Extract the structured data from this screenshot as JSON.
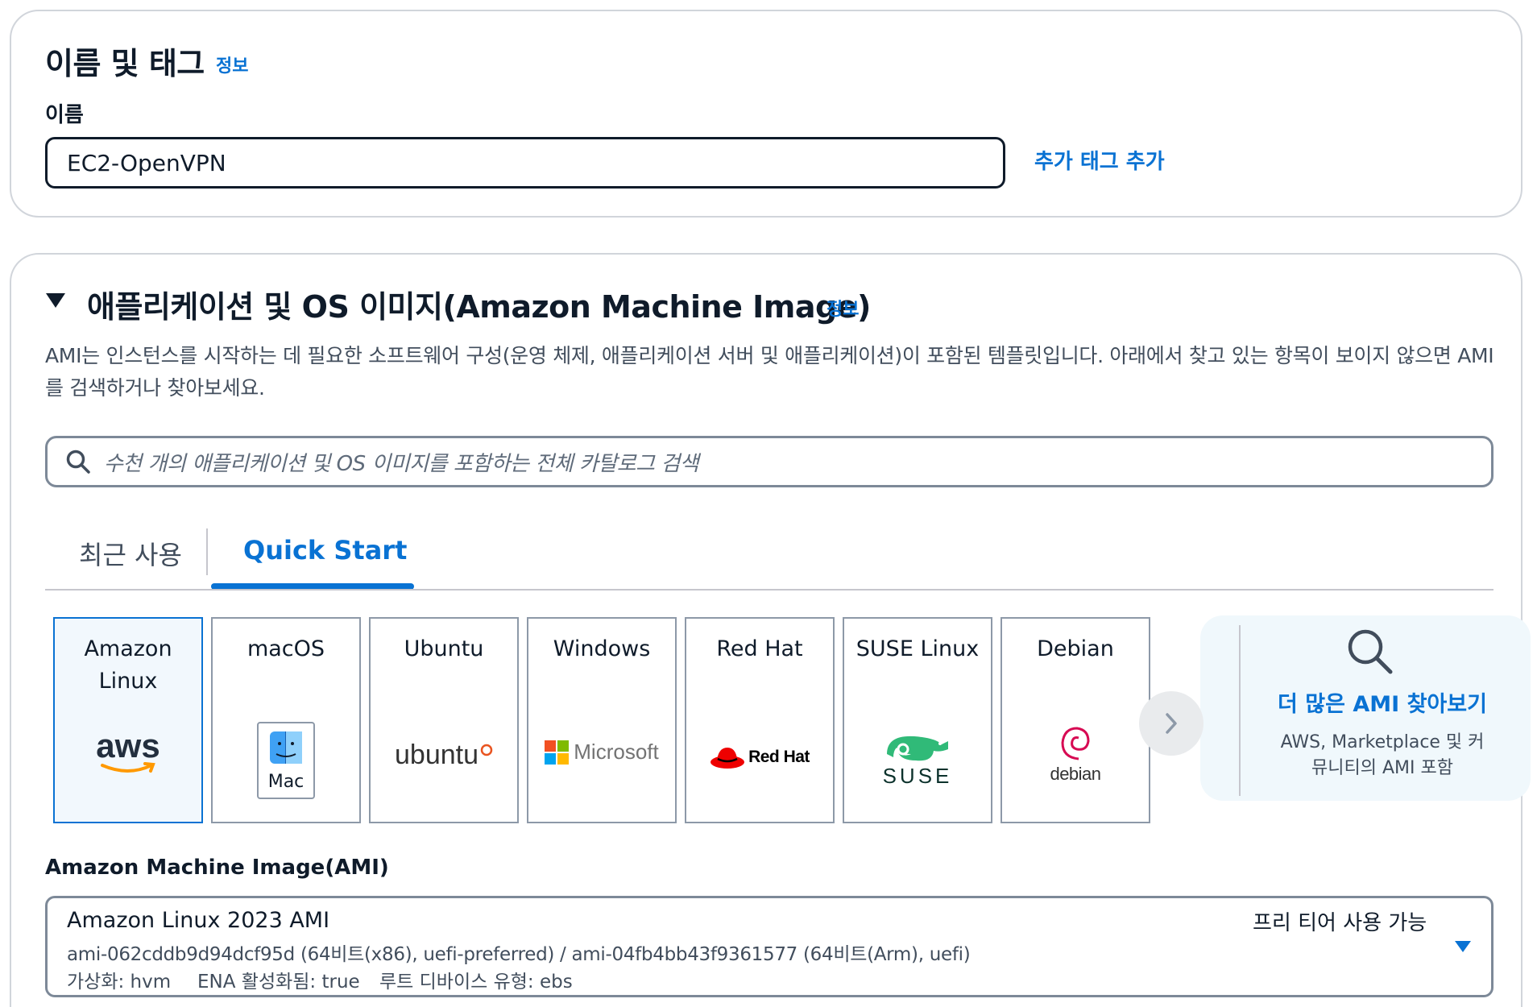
{
  "name_tags": {
    "title": "이름 및 태그",
    "info": "정보",
    "name_label": "이름",
    "name_value": "EC2-OpenVPN",
    "add_tags": "추가 태그 추가"
  },
  "ami_section": {
    "title": "애플리케이션 및 OS 이미지(Amazon Machine Image)",
    "info": "정보",
    "description": "AMI는 인스턴스를 시작하는 데 필요한 소프트웨어 구성(운영 체제, 애플리케이션 서버 및 애플리케이션)이 포함된 템플릿입니다. 아래에서 찾고 있는 항목이 보이지 않으면 AMI를 검색하거나 찾아보세요.",
    "search_placeholder": "수천 개의 애플리케이션 및 OS 이미지를 포함하는 전체 카탈로그 검색",
    "tabs": [
      "최근 사용",
      "Quick Start"
    ],
    "tiles": [
      {
        "label": "Amazon Linux",
        "logo_text": "aws"
      },
      {
        "label": "macOS",
        "logo_text": "Mac"
      },
      {
        "label": "Ubuntu",
        "logo_text": "ubuntu"
      },
      {
        "label": "Windows",
        "logo_text": "Microsoft"
      },
      {
        "label": "Red Hat",
        "logo_text": "Red Hat"
      },
      {
        "label": "SUSE Linux",
        "logo_text": "SUSE"
      },
      {
        "label": "Debian",
        "logo_text": "debian"
      }
    ],
    "browse_more": {
      "title": "더 많은 AMI 찾아보기",
      "subtitle": "AWS, Marketplace 및 커뮤니티의 AMI 포함"
    },
    "ami_label": "Amazon Machine Image(AMI)",
    "selected_ami": {
      "name": "Amazon Linux 2023 AMI",
      "free_tier": "프리 티어 사용 가능",
      "ids": "ami-062cddb9d94dcf95d (64비트(x86), uefi-preferred) / ami-04fb4bb43f9361577 (64비트(Arm), uefi)",
      "virtualization": "가상화: hvm",
      "ena": "ENA 활성화됨: true",
      "root_device": "루트 디바이스 유형: ebs"
    }
  },
  "colors": {
    "link": "#0972d3",
    "text": "#0f1b2a",
    "selected_bg": "#f2f8fd"
  }
}
